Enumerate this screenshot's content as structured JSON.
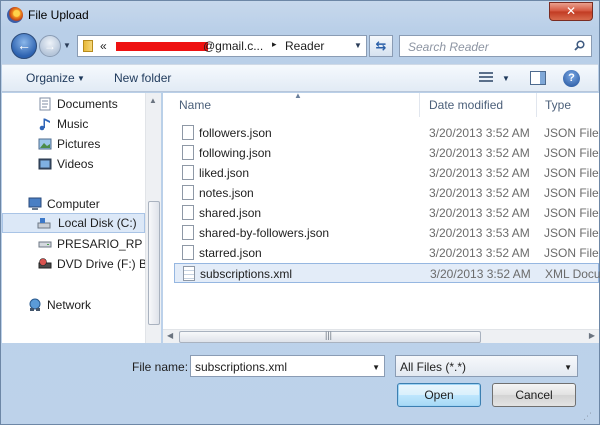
{
  "window": {
    "title": "File Upload",
    "close_label": "✕"
  },
  "address": {
    "chevron": "«",
    "email_suffix": "@gmail.c...",
    "separator": "▸",
    "current_folder": "Reader"
  },
  "search": {
    "placeholder": "Search Reader"
  },
  "commandbar": {
    "organize_label": "Organize",
    "newfolder_label": "New folder"
  },
  "navpane": {
    "items": [
      {
        "label": "Documents",
        "icon": "documents-icon"
      },
      {
        "label": "Music",
        "icon": "music-icon"
      },
      {
        "label": "Pictures",
        "icon": "pictures-icon"
      },
      {
        "label": "Videos",
        "icon": "videos-icon"
      },
      {
        "label": "Computer",
        "icon": "computer-icon"
      },
      {
        "label": "Local Disk (C:)",
        "icon": "local-disk-icon"
      },
      {
        "label": "PRESARIO_RP (D:",
        "icon": "drive-icon"
      },
      {
        "label": "DVD Drive (F:) BR",
        "icon": "dvd-drive-icon"
      },
      {
        "label": "Network",
        "icon": "network-icon"
      }
    ]
  },
  "filelist": {
    "columns": [
      "Name",
      "Date modified",
      "Type"
    ],
    "rows": [
      {
        "name": "followers.json",
        "date": "3/20/2013 3:52 AM",
        "type": "JSON File"
      },
      {
        "name": "following.json",
        "date": "3/20/2013 3:52 AM",
        "type": "JSON File"
      },
      {
        "name": "liked.json",
        "date": "3/20/2013 3:52 AM",
        "type": "JSON File"
      },
      {
        "name": "notes.json",
        "date": "3/20/2013 3:52 AM",
        "type": "JSON File"
      },
      {
        "name": "shared.json",
        "date": "3/20/2013 3:52 AM",
        "type": "JSON File"
      },
      {
        "name": "shared-by-followers.json",
        "date": "3/20/2013 3:53 AM",
        "type": "JSON File"
      },
      {
        "name": "starred.json",
        "date": "3/20/2013 3:52 AM",
        "type": "JSON File"
      },
      {
        "name": "subscriptions.xml",
        "date": "3/20/2013 3:52 AM",
        "type": "XML Docu"
      }
    ],
    "selected_row": 7
  },
  "bottom": {
    "filename_label": "File name:",
    "filename_value": "subscriptions.xml",
    "filter_value": "All Files (*.*)",
    "open_label": "Open",
    "cancel_label": "Cancel"
  },
  "colors": {
    "accent": "#3c7fb1",
    "redaction": "#ee1111",
    "selection": "#e3ecf8"
  }
}
